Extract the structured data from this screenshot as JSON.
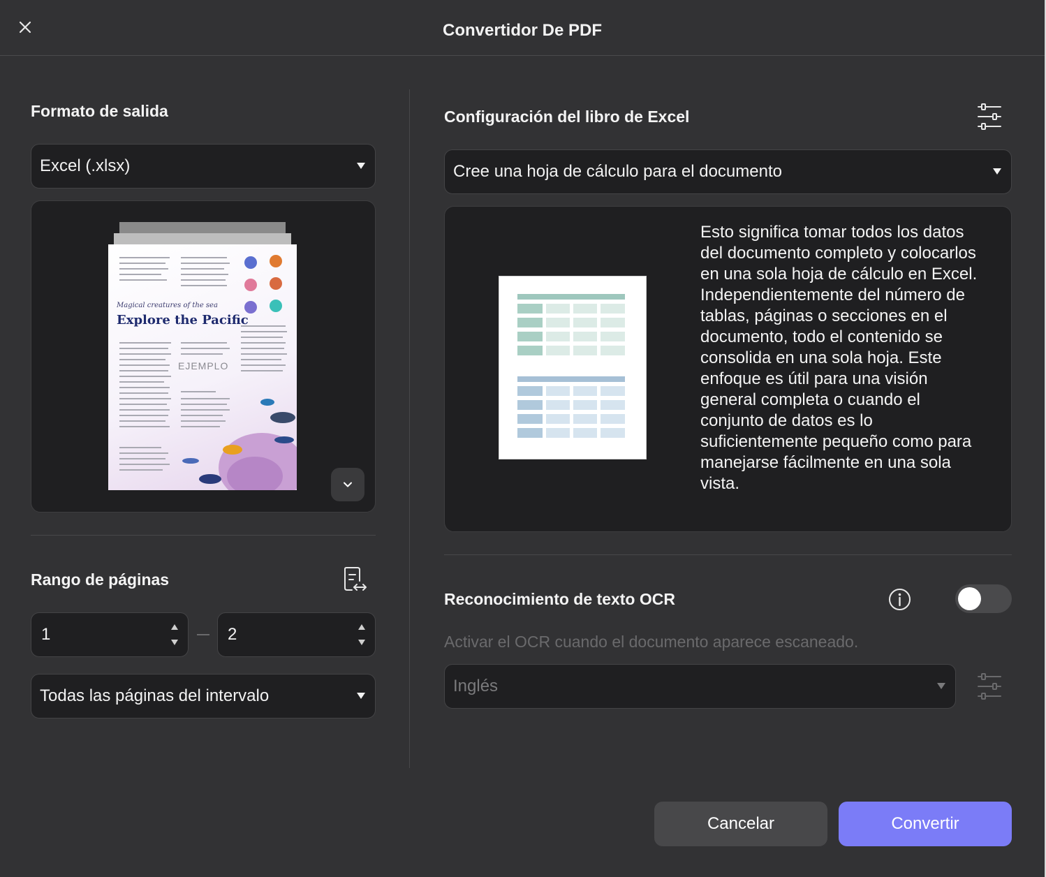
{
  "dialog": {
    "title": "Convertidor De PDF"
  },
  "output_format": {
    "heading": "Formato de salida",
    "selected": "Excel (.xlsx)"
  },
  "preview": {
    "subtitle": "Magical creatures of the sea",
    "headline": "Explore the Pacific",
    "watermark": "EJEMPLO"
  },
  "page_range": {
    "heading": "Rango de páginas",
    "from": "1",
    "to": "2",
    "subset": "Todas las páginas del intervalo"
  },
  "excel_config": {
    "heading": "Configuración del libro de Excel",
    "mode": "Cree una hoja de cálculo para el documento",
    "description": "Esto significa tomar todos los datos del documento completo y colocarlos en una sola hoja de cálculo en Excel. Independientemente del número de tablas, páginas o secciones en el documento, todo el contenido se consolida en una sola hoja. Este enfoque es útil para una visión general completa o cuando el conjunto de datos es lo suficientemente pequeño como para manejarse fácilmente en una sola vista."
  },
  "ocr": {
    "heading": "Reconocimiento de texto OCR",
    "enabled": false,
    "hint": "Activar el OCR cuando el documento aparece escaneado.",
    "language": "Inglés"
  },
  "actions": {
    "cancel": "Cancelar",
    "convert": "Convertir"
  },
  "colors": {
    "accent": "#7b7cf7",
    "background": "#323234",
    "field": "#1f1f21"
  },
  "icons": [
    "close-icon",
    "caret-down-icon",
    "chevron-down-icon",
    "page-range-icon",
    "sliders-icon",
    "info-icon"
  ]
}
